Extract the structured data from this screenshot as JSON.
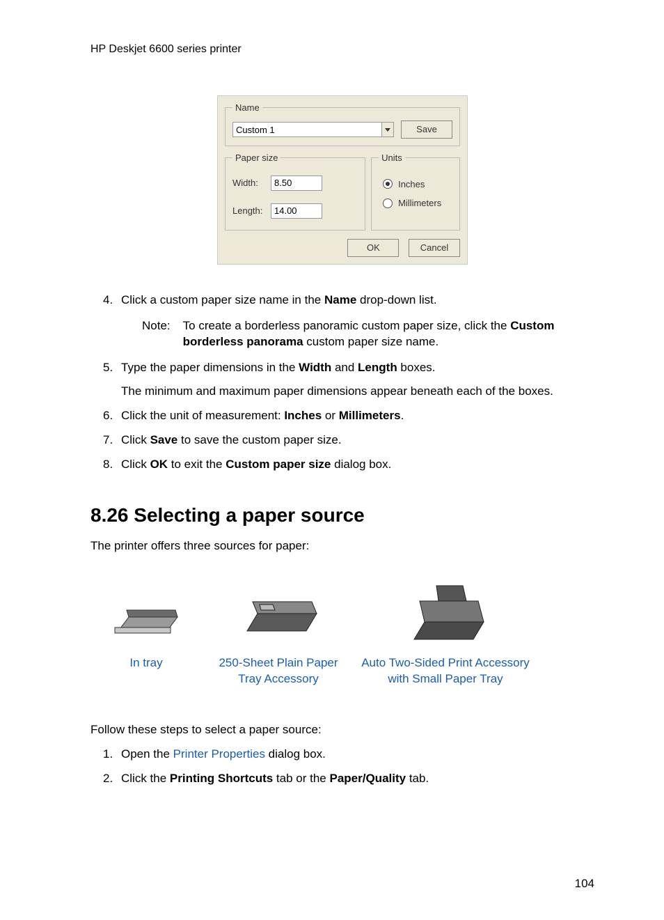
{
  "header": "HP Deskjet 6600 series printer",
  "dialog": {
    "name_fieldset": {
      "legend": "Name",
      "value": "Custom 1",
      "save": "Save"
    },
    "paper_size": {
      "legend": "Paper size",
      "width_label": "Width:",
      "width_value": "8.50",
      "length_label": "Length:",
      "length_value": "14.00"
    },
    "units": {
      "legend": "Units",
      "inches": "Inches",
      "millimeters": "Millimeters"
    },
    "ok": "OK",
    "cancel": "Cancel"
  },
  "steps_a": {
    "s4": {
      "num": "4.",
      "before": "Click a custom paper size name in the ",
      "bold": "Name",
      "after": " drop-down list."
    },
    "note": {
      "label": "Note:",
      "before": "To create a borderless panoramic custom paper size, click the ",
      "bold": "Custom borderless panorama",
      "after": " custom paper size name."
    },
    "s5": {
      "num": "5.",
      "before": "Type the paper dimensions in the ",
      "bold1": "Width",
      "mid": " and ",
      "bold2": "Length",
      "after": " boxes.",
      "p2": "The minimum and maximum paper dimensions appear beneath each of the boxes."
    },
    "s6": {
      "num": "6.",
      "before": "Click the unit of measurement: ",
      "bold1": "Inches",
      "mid": " or ",
      "bold2": "Millimeters",
      "after": "."
    },
    "s7": {
      "num": "7.",
      "before": "Click ",
      "bold": "Save",
      "after": " to save the custom paper size."
    },
    "s8": {
      "num": "8.",
      "before": "Click ",
      "bold1": "OK",
      "mid": " to exit the ",
      "bold2": "Custom paper size",
      "after": " dialog box."
    }
  },
  "section": {
    "heading": "8.26  Selecting a paper source",
    "intro": "The printer offers three sources for paper:",
    "tray1": "In tray",
    "tray2a": "250-Sheet Plain Paper",
    "tray2b": "Tray Accessory",
    "tray3a": "Auto Two-Sided Print Accessory",
    "tray3b": "with Small Paper Tray",
    "follow": "Follow these steps to select a paper source:",
    "b1": {
      "num": "1.",
      "before": "Open the ",
      "link": "Printer Properties",
      "after": " dialog box."
    },
    "b2": {
      "num": "2.",
      "before": "Click the ",
      "bold1": "Printing Shortcuts",
      "mid": " tab or the ",
      "bold2": "Paper/Quality",
      "after": " tab."
    }
  },
  "page_num": "104"
}
